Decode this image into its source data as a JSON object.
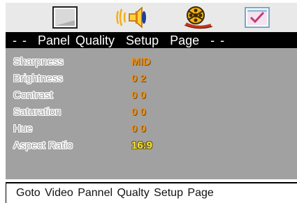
{
  "tabs": [
    {
      "name": "general-setup-tab",
      "icon": "monitor-frame-icon"
    },
    {
      "name": "audio-setup-tab",
      "icon": "speaker-sound-icon"
    },
    {
      "name": "video-setup-tab",
      "icon": "film-reel-icon"
    },
    {
      "name": "preference-setup-tab",
      "icon": "checkmark-screen-icon"
    }
  ],
  "title": "- -  Panel Quality  Setup  Page  - -",
  "settings": [
    {
      "label": "Sharpness",
      "value": "MID"
    },
    {
      "label": "Brightness",
      "value": "0 2"
    },
    {
      "label": "Contrast",
      "value": "0 0"
    },
    {
      "label": "Saturation",
      "value": "0 0"
    },
    {
      "label": "Hue",
      "value": "0 0"
    },
    {
      "label": "Aspect Ratio",
      "value": "16:9"
    }
  ],
  "footer": "Goto Video Pannel Qualty Setup Page",
  "colors": {
    "title_bg": "#000000",
    "panel_bg": "#a1a1a1",
    "value_orange": "#e58f1c",
    "value_yellow": "#f7e23a",
    "tabbar_bg": "#e9e9e9"
  }
}
